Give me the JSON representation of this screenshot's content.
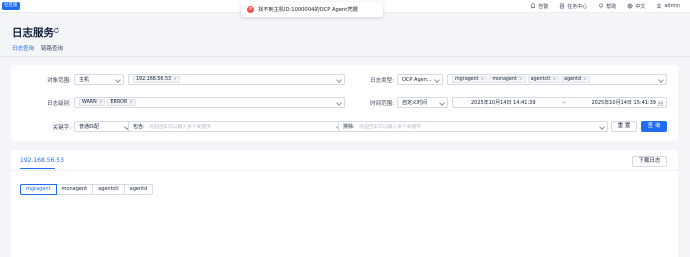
{
  "topbar": {
    "trial_tag": "社区版",
    "toast_icon": "error-icon",
    "toast_text": "找不到主机ID:1000004的OCP Agent凭据",
    "nav": [
      {
        "icon": "bell-icon",
        "label": "告警"
      },
      {
        "icon": "task-icon",
        "label": "任务中心"
      },
      {
        "icon": "help-icon",
        "label": "帮助"
      },
      {
        "icon": "globe-icon",
        "label": "中文"
      },
      {
        "icon": "user-icon",
        "label": "admin"
      }
    ]
  },
  "page": {
    "title": "日志服务",
    "tabs": [
      {
        "label": "日志查询",
        "active": true
      },
      {
        "label": "链路查询",
        "active": false
      }
    ]
  },
  "filters": {
    "scope_label": "对象范围:",
    "scope_type": "主机",
    "scope_hosts": [
      "192.168.56.53"
    ],
    "log_type_label": "日志类型:",
    "log_type_select": "OCP Agen...",
    "log_types": [
      "mgragent",
      "monagent",
      "agentctl",
      "agentd"
    ],
    "level_label": "日志级别:",
    "levels": [
      "WARN",
      "ERROR"
    ],
    "time_label": "时间范围:",
    "time_mode": "自定义时间",
    "time_start": "2025年10月14日 14:41:39",
    "time_sep": "→",
    "time_end": "2025年10月14日 15:41:39",
    "keyword_label": "关键字:",
    "match_mode": "普通匹配",
    "include_label": "包含:",
    "include_placeholder": "点击回车可以输入多个关键字",
    "exclude_label": "排除:",
    "exclude_placeholder": "点击回车可以输入多个关键字",
    "reset_button": "重 置",
    "query_button": "查 询"
  },
  "log_panel": {
    "host_tab": "192.168.56.53",
    "download_button": "下载日志",
    "agents": [
      {
        "label": "mgragent",
        "active": true
      },
      {
        "label": "monagent",
        "active": false
      },
      {
        "label": "agentctl",
        "active": false
      },
      {
        "label": "agentd",
        "active": false
      }
    ]
  },
  "colors": {
    "primary": "#1f6cf1",
    "error": "#f24c4c",
    "background": "#f3f5f9"
  }
}
